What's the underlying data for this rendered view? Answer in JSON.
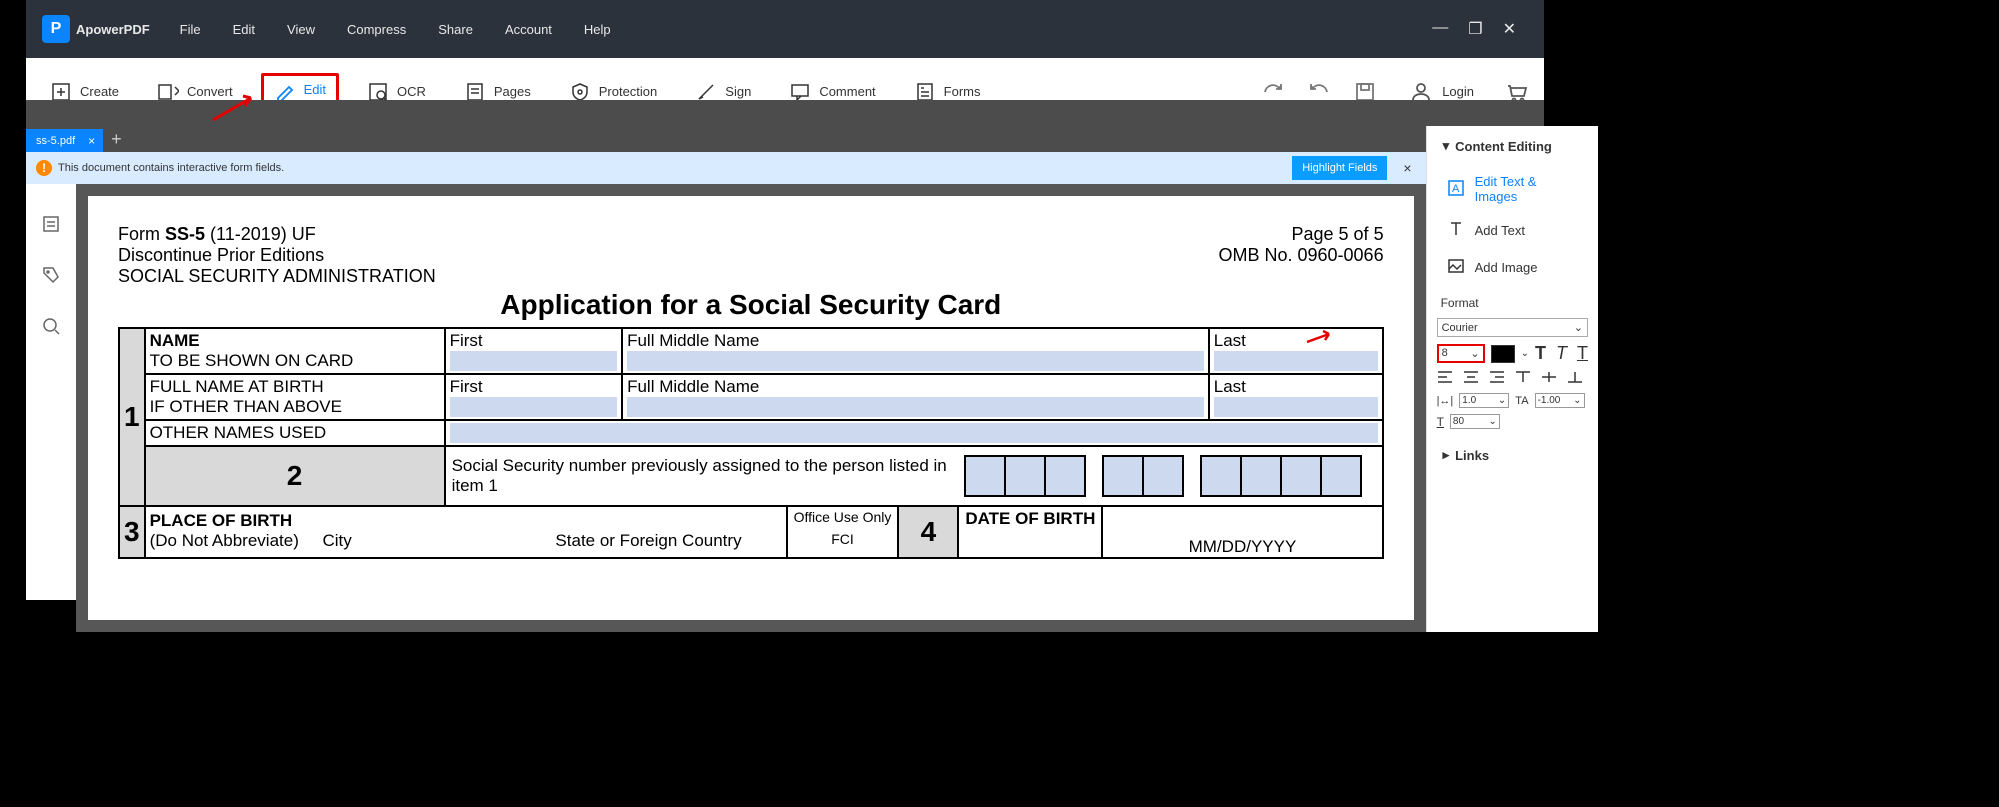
{
  "app": {
    "name": "ApowerPDF"
  },
  "menu": [
    "File",
    "Edit",
    "View",
    "Compress",
    "Share",
    "Account",
    "Help"
  ],
  "toolbar": [
    {
      "label": "Create",
      "name": "create-button"
    },
    {
      "label": "Convert",
      "name": "convert-button"
    },
    {
      "label": "Edit",
      "name": "edit-button",
      "active": true
    },
    {
      "label": "OCR",
      "name": "ocr-button"
    },
    {
      "label": "Pages",
      "name": "pages-button"
    },
    {
      "label": "Protection",
      "name": "protection-button"
    },
    {
      "label": "Sign",
      "name": "sign-button"
    },
    {
      "label": "Comment",
      "name": "comment-button"
    },
    {
      "label": "Forms",
      "name": "forms-button"
    }
  ],
  "login_label": "Login",
  "tab": {
    "name": "ss-5.pdf"
  },
  "notif": {
    "text": "This document contains interactive form fields.",
    "highlight": "Highlight Fields"
  },
  "doc": {
    "form_line": "Form SS-5 (11-2019) UF",
    "discontinue": "Discontinue Prior Editions",
    "admin": "SOCIAL SECURITY ADMINISTRATION",
    "page": "Page 5 of 5",
    "omb": "OMB No. 0960-0066",
    "title": "Application for a Social Security Card",
    "row1": {
      "num": "1",
      "name_label": "NAME",
      "to_be": "TO BE SHOWN ON CARD",
      "full_birth": "FULL NAME AT BIRTH",
      "if_other": "IF OTHER THAN ABOVE",
      "other_names": "OTHER NAMES USED",
      "first": "First",
      "middle": "Full Middle Name",
      "last": "Last"
    },
    "row2": {
      "num": "2",
      "text": "Social Security number previously assigned to the person listed in item 1"
    },
    "row3": {
      "num": "3",
      "place": "PLACE OF BIRTH",
      "note": "(Do Not Abbreviate)",
      "city": "City",
      "state": "State or Foreign Country",
      "office": "Office Use Only",
      "fci": "FCI",
      "num4": "4",
      "date": "DATE OF BIRTH",
      "mm": "MM/DD/YYYY"
    }
  },
  "panel": {
    "content_editing": "Content Editing",
    "edit_text": "Edit Text & Images",
    "add_text": "Add Text",
    "add_image": "Add Image",
    "format": "Format",
    "font": "Courier",
    "size": "8",
    "line1": "1.0",
    "char1": "-1.00",
    "char2": "80",
    "links": "Links"
  }
}
